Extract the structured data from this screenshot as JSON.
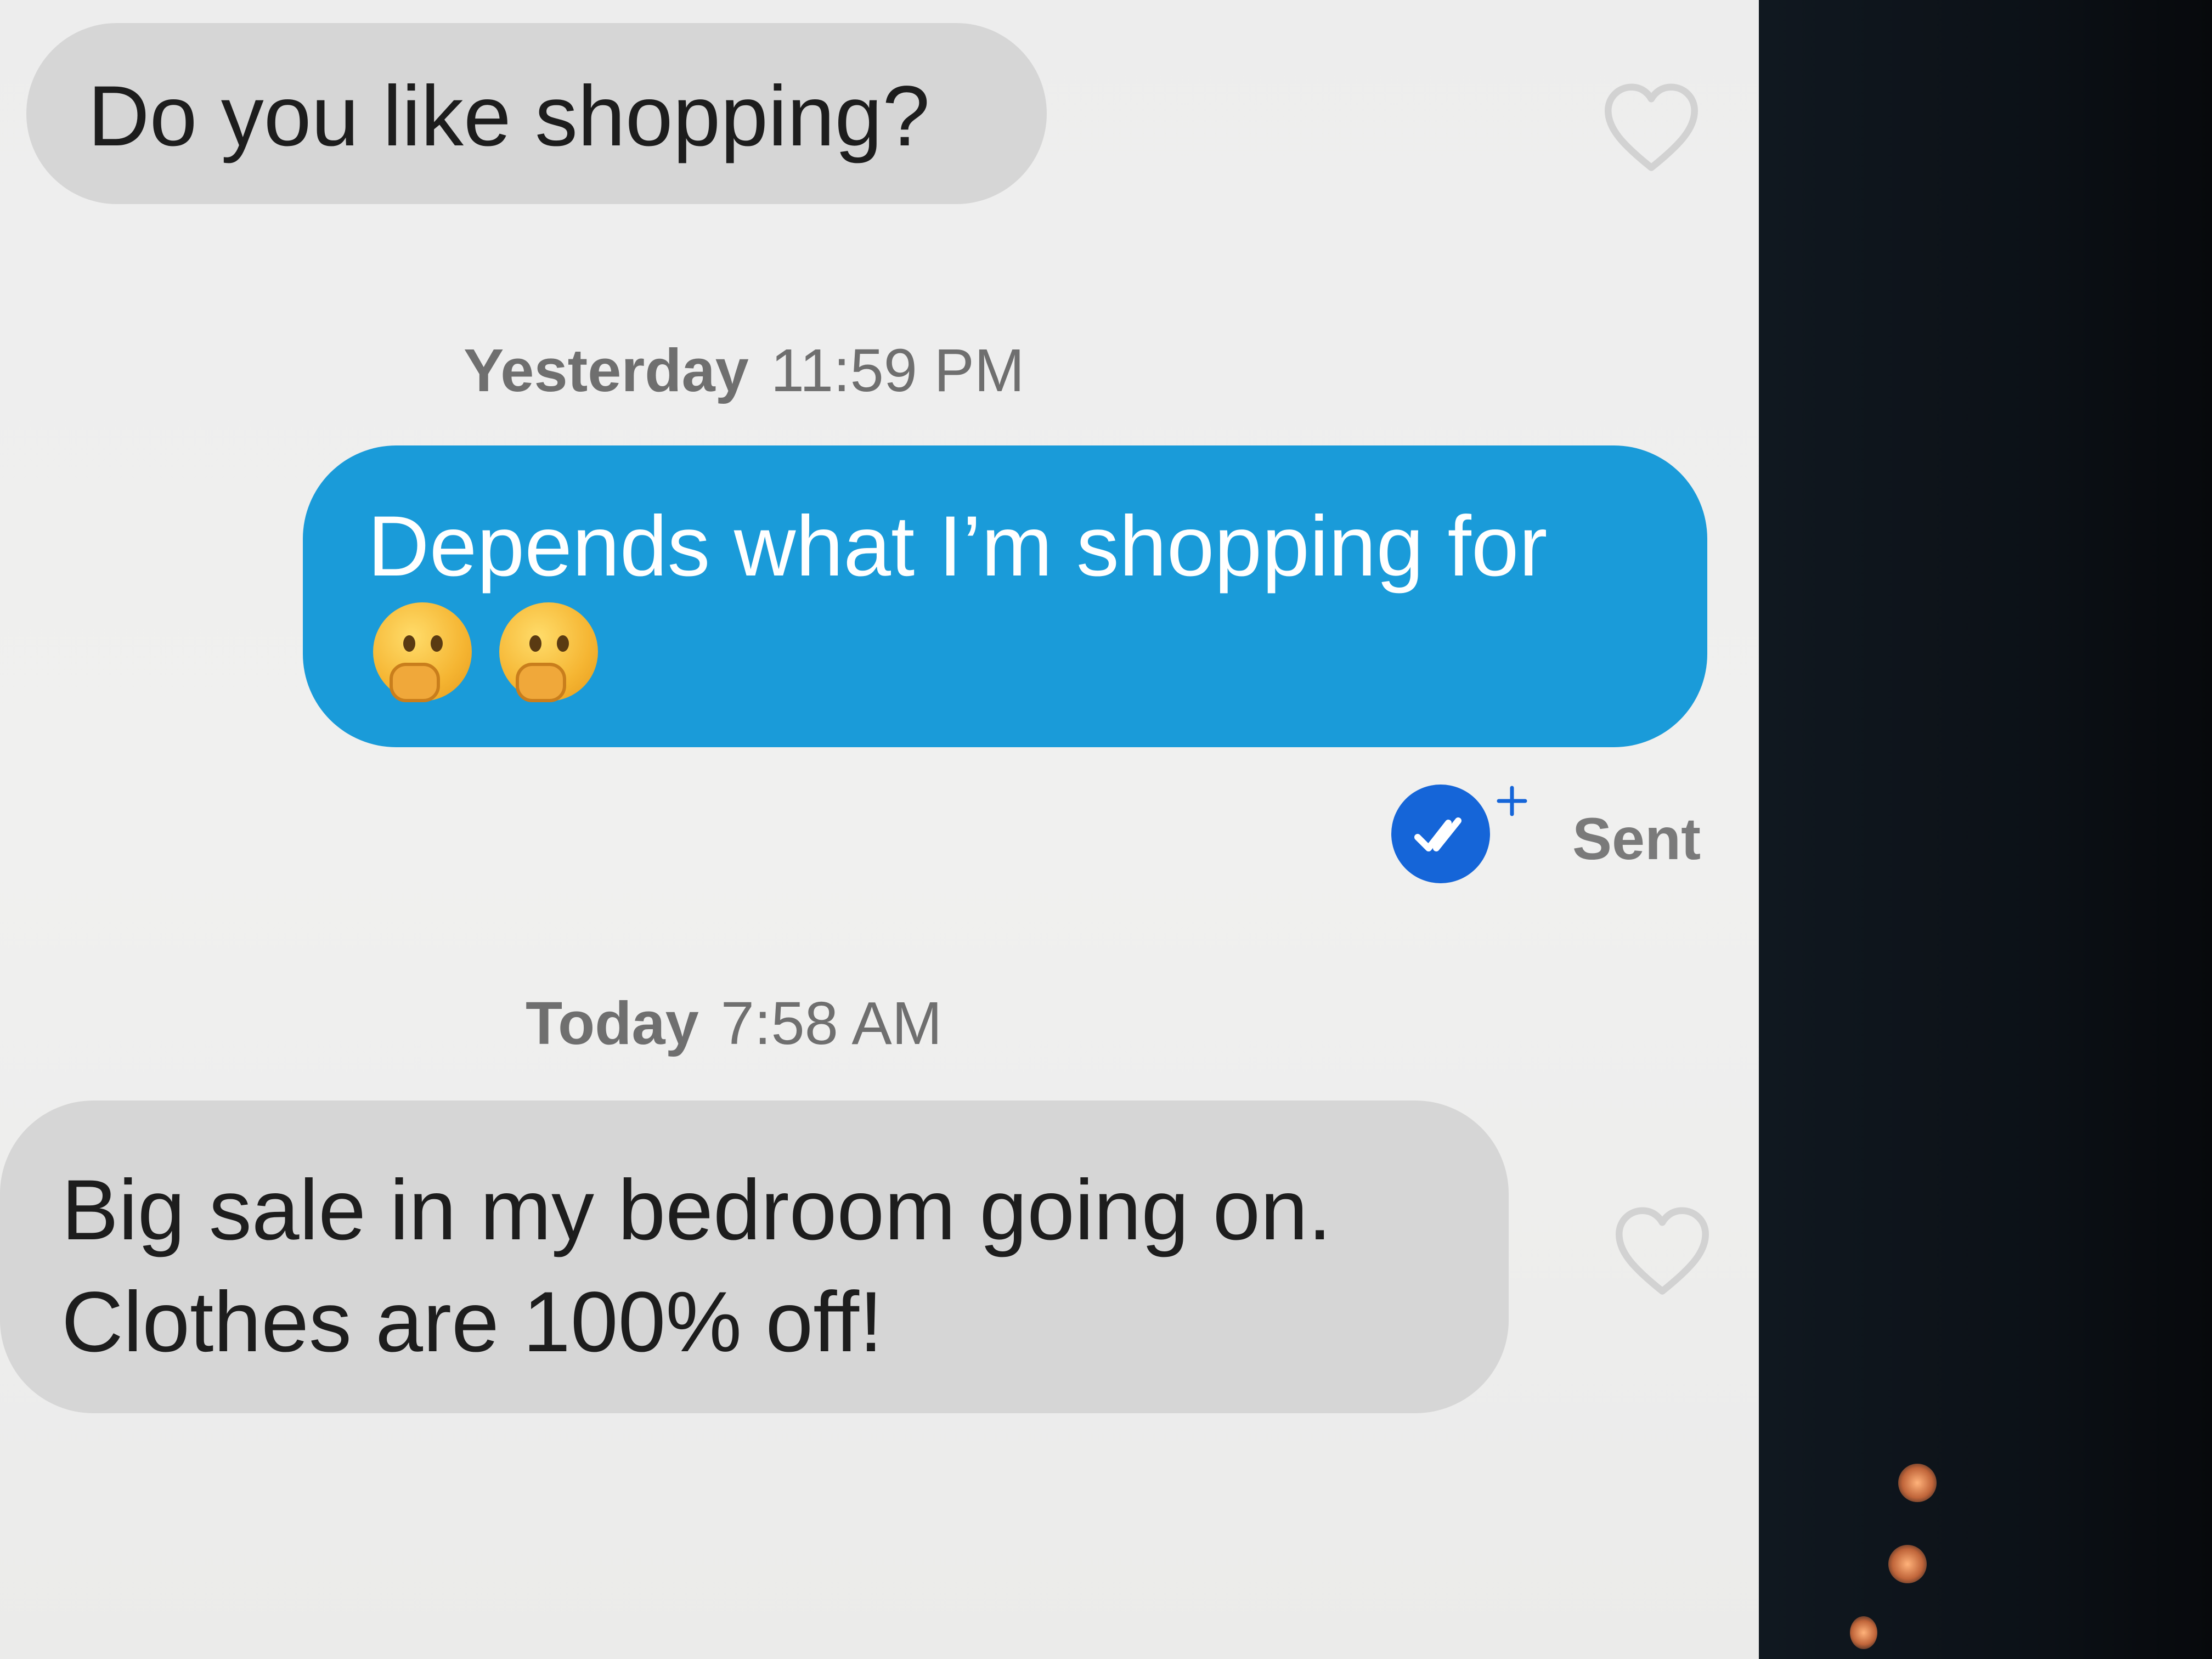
{
  "conversation": {
    "messages": [
      {
        "direction": "incoming",
        "text": "Do you like shopping?"
      },
      {
        "direction": "outgoing",
        "text": "Depends what I’m shopping for",
        "emoji": [
          "thinking-face",
          "thinking-face"
        ]
      },
      {
        "direction": "incoming",
        "text": "Big sale in my bedroom going on.\nClothes are 100% off!"
      }
    ],
    "timestamps": [
      {
        "day": "Yesterday",
        "time": "11:59 PM"
      },
      {
        "day": "Today",
        "time": "7:58 AM"
      }
    ],
    "status": "Sent"
  },
  "icons": {
    "like": "heart-outline-icon",
    "read_receipt": "double-check-icon",
    "emoji": "thinking-face-emoji"
  },
  "colors": {
    "incoming_bubble": "#d6d6d6",
    "outgoing_bubble": "#1a9bd9",
    "read_badge": "#1565d8",
    "background": "#efefee"
  }
}
